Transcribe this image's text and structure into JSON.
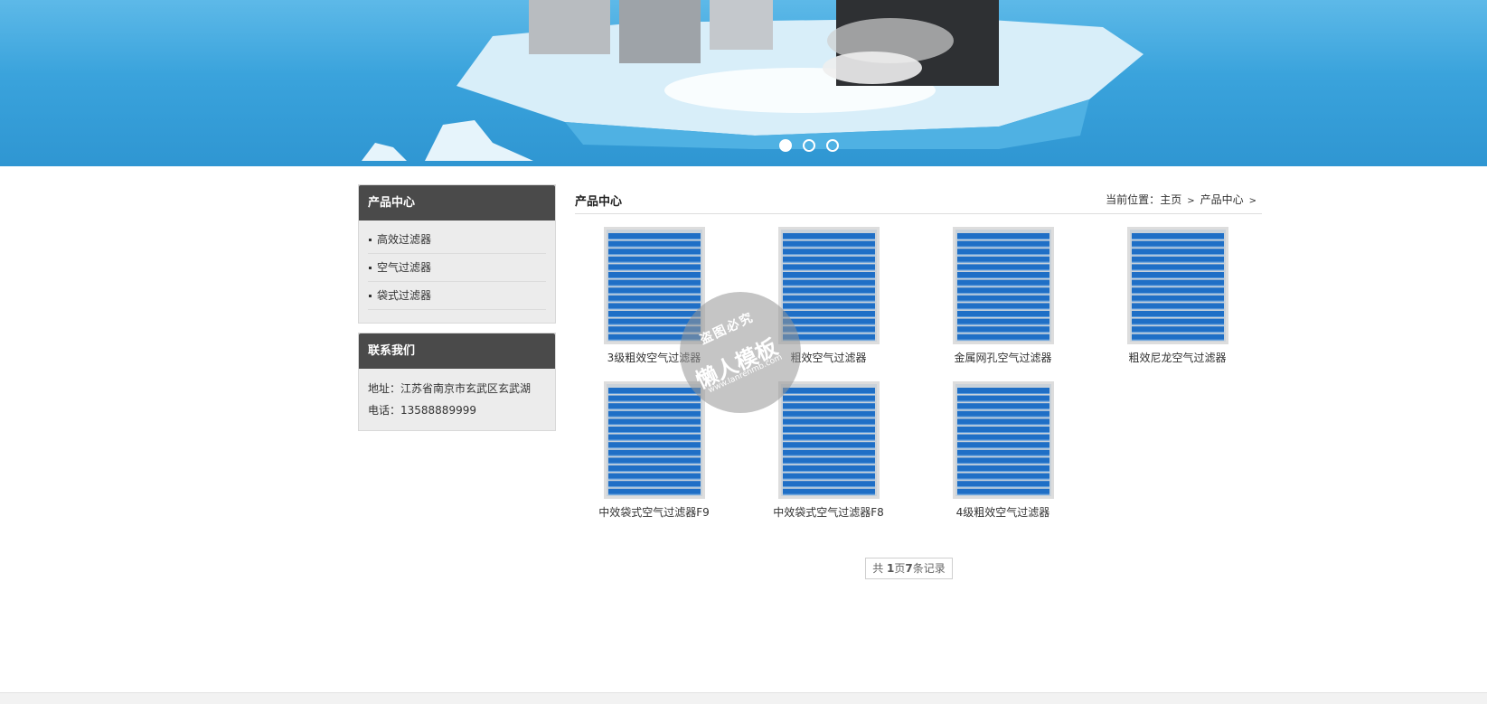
{
  "banner": {
    "dots": [
      {
        "name": "slide-1",
        "active": true
      },
      {
        "name": "slide-2",
        "active": false
      },
      {
        "name": "slide-3",
        "active": false
      }
    ]
  },
  "sidebar": {
    "products": {
      "title": "产品中心",
      "items": [
        "高效过滤器",
        "空气过滤器",
        "袋式过滤器"
      ]
    },
    "contact": {
      "title": "联系我们",
      "address": "地址：江苏省南京市玄武区玄武湖",
      "phone": "电话：13588889999"
    }
  },
  "main": {
    "title": "产品中心",
    "breadcrumb": {
      "prefix": "当前位置：",
      "home": "主页",
      "current": "产品中心",
      "sep": ">"
    },
    "products": [
      {
        "name": "3级粗效空气过滤器"
      },
      {
        "name": "粗效空气过滤器"
      },
      {
        "name": "金属网孔空气过滤器"
      },
      {
        "name": "粗效尼龙空气过滤器"
      },
      {
        "name": "中效袋式空气过滤器F9"
      },
      {
        "name": "中效袋式空气过滤器F8"
      },
      {
        "name": "4级粗效空气过滤器"
      }
    ],
    "pager": {
      "prefix": "共 ",
      "pages": "1",
      "mid": "页",
      "records": "7",
      "suffix": "条记录"
    }
  },
  "watermark": {
    "line1": "盗图必究",
    "line2": "懒人模板",
    "line3": "www.lanrenmb.com"
  },
  "colors": {
    "filter_blue": "#1f6fc6",
    "header_dark": "#4a4a4a",
    "sky": "#3aa3dc"
  }
}
